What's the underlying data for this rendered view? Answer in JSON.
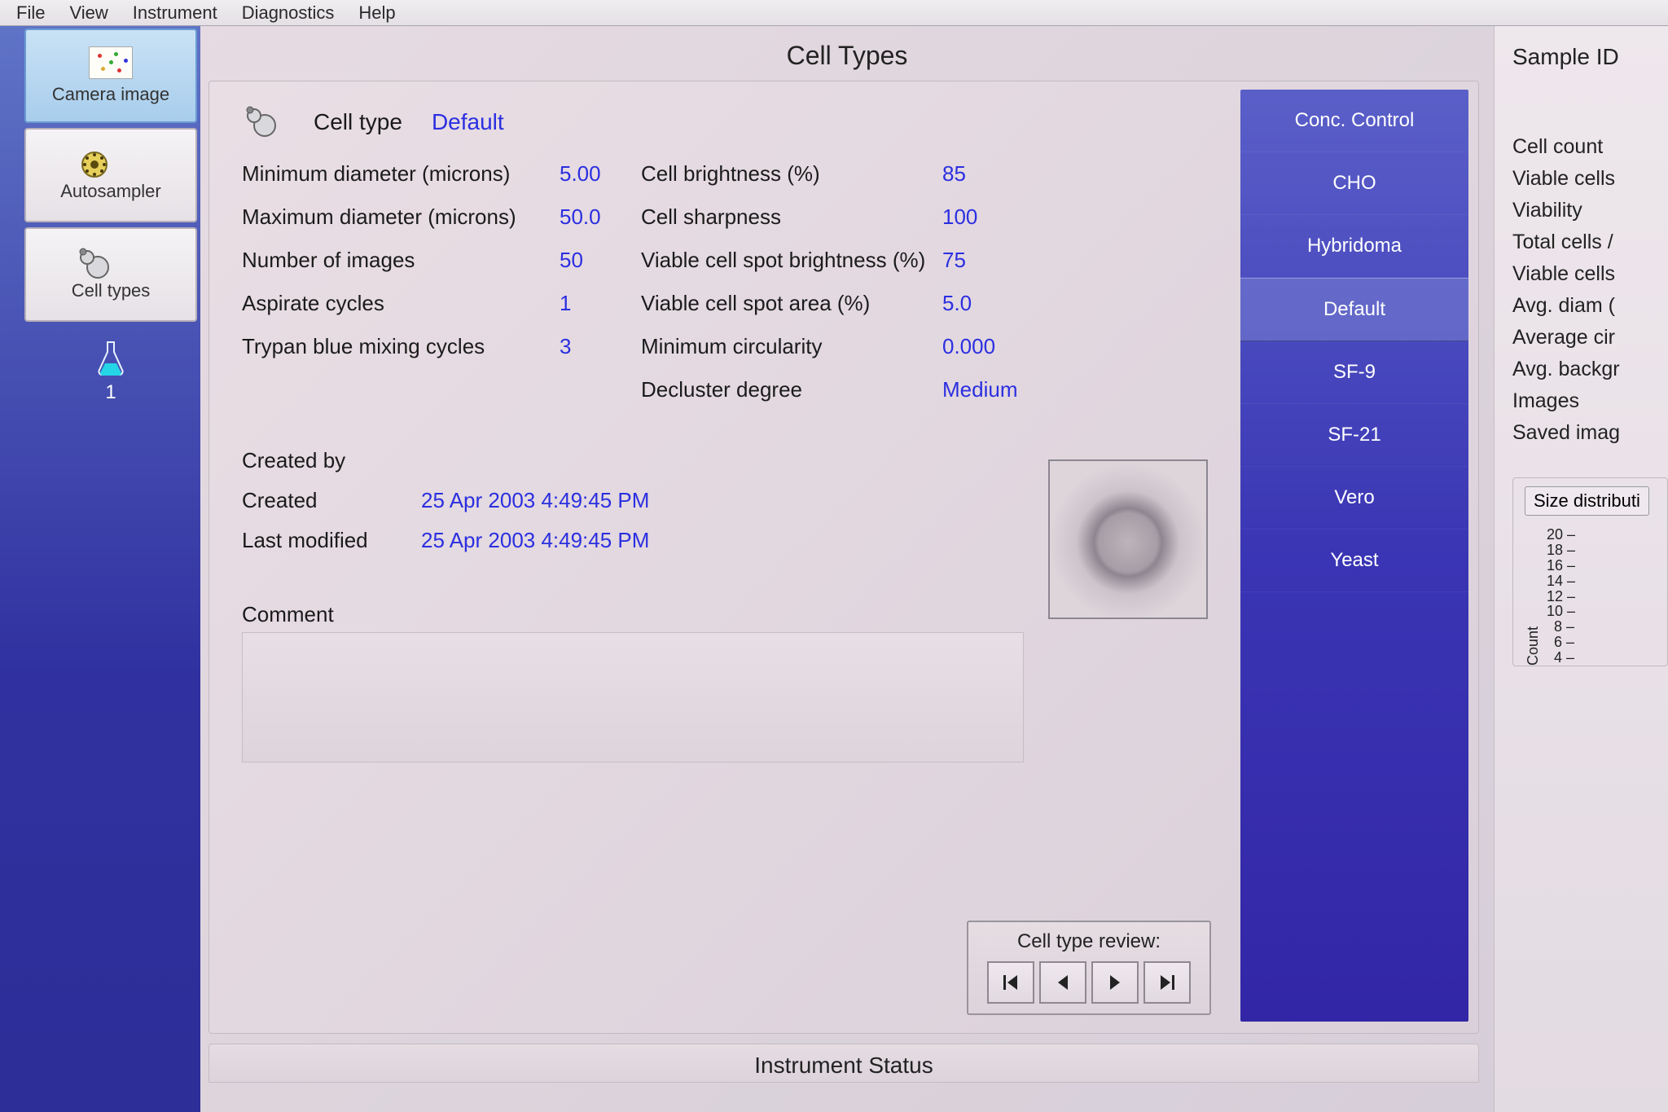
{
  "menu": {
    "file": "File",
    "view": "View",
    "instrument": "Instrument",
    "diagnostics": "Diagnostics",
    "help": "Help"
  },
  "sidebar": {
    "items": [
      {
        "label": "Camera image"
      },
      {
        "label": "Autosampler"
      },
      {
        "label": "Cell types"
      }
    ],
    "flask_count": "1"
  },
  "panel": {
    "title": "Cell Types",
    "cell_type_label": "Cell type",
    "cell_type_value": "Default",
    "params_left": [
      {
        "label": "Minimum diameter (microns)",
        "value": "5.00"
      },
      {
        "label": "Maximum diameter (microns)",
        "value": "50.0"
      },
      {
        "label": "Number of images",
        "value": "50"
      },
      {
        "label": "Aspirate cycles",
        "value": "1"
      },
      {
        "label": "Trypan blue mixing cycles",
        "value": "3"
      }
    ],
    "params_right": [
      {
        "label": "Cell brightness (%)",
        "value": "85"
      },
      {
        "label": "Cell sharpness",
        "value": "100"
      },
      {
        "label": "Viable cell spot brightness (%)",
        "value": "75"
      },
      {
        "label": "Viable cell spot area (%)",
        "value": "5.0"
      },
      {
        "label": "Minimum circularity",
        "value": "0.000"
      },
      {
        "label": "Decluster degree",
        "value": "Medium"
      }
    ],
    "meta": {
      "created_by_label": "Created by",
      "created_by_value": "",
      "created_label": "Created",
      "created_value": "25 Apr 2003  4:49:45 PM",
      "modified_label": "Last modified",
      "modified_value": "25 Apr 2003  4:49:45 PM"
    },
    "comment_label": "Comment",
    "review": {
      "title": "Cell type review:"
    }
  },
  "type_list": [
    "Conc. Control",
    "CHO",
    "Hybridoma",
    "Default",
    "SF-9",
    "SF-21",
    "Vero",
    "Yeast"
  ],
  "type_list_selected_index": 3,
  "status": {
    "title": "Instrument Status"
  },
  "right": {
    "sample_id_label": "Sample ID",
    "metrics": [
      "Cell count",
      "Viable cells",
      "Viability",
      "Total cells /",
      "Viable cells",
      "Avg. diam (",
      "Average cir",
      "Avg. backgr",
      "Images",
      "Saved imag"
    ],
    "chart_label": "Size distributi",
    "y_axis_label": "Count",
    "y_ticks": [
      "20",
      "18",
      "16",
      "14",
      "12",
      "10",
      "8",
      "6",
      "4"
    ]
  }
}
